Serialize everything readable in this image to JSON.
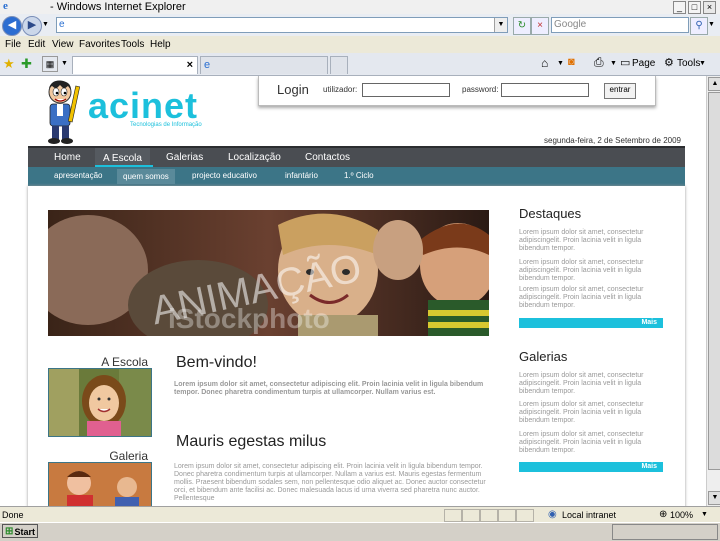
{
  "window": {
    "title": "- Windows Internet Explorer"
  },
  "address_bar": {
    "search_placeholder": "Google"
  },
  "menu": [
    "File",
    "Edit",
    "View",
    "Favorites",
    "Tools",
    "Help"
  ],
  "toolbar": {
    "page_label": "Page",
    "tools_label": "Tools"
  },
  "login": {
    "title": "Login",
    "user_label": "utilizador:",
    "password_label": "password:",
    "button": "entrar"
  },
  "logo": {
    "text": "acinet",
    "tagline": "Tecnologias de Informação"
  },
  "date": "segunda-feira, 2 de Setembro de 2009",
  "main_nav": [
    "Home",
    "A Escola",
    "Galerias",
    "Localização",
    "Contactos"
  ],
  "main_nav_active": "A Escola",
  "sub_nav": [
    "apresentação",
    "quem somos",
    "projecto educativo",
    "infantário",
    "1.º Ciclo"
  ],
  "sub_nav_active": "quem somos",
  "banner": {
    "watermark1": "ANIMAÇÃO",
    "watermark2": "iStockphoto"
  },
  "sidebar_left": {
    "escola_title": "A Escola",
    "galeria_title": "Galeria"
  },
  "content": {
    "welcome_title": "Bem-vindo!",
    "welcome_text": "Lorem ipsum dolor sit amet, consectetur adipiscing elit. Proin lacinia velit in ligula bibendum tempor. Donec pharetra condimentum turpis at ullamcorper. Nullam varius est.",
    "section2_title": "Mauris egestas milus",
    "section2_text": "Lorem ipsum dolor sit amet, consectetur adipiscing elit. Proin lacinia velit in ligula bibendum tempor. Donec pharetra condimentum turpis at ullamcorper. Nullam a varius est. Mauris egestas fermentum mollis. Praesent bibendum sodales sem, non pellentesque odio aliquet ac. Donec auctor consectetur orci, et bibendum ante facilisi ac. Donec malesuada lacus id urna viverra sed pharetra nunc auctor. Pellentesque"
  },
  "destaques": {
    "title": "Destaques",
    "items": [
      "Lorem ipsum dolor sit amet, consectetur adipiscingelit. Proin lacinia velit in ligula bibendum tempor.",
      "Lorem ipsum dolor sit amet, consectetur adipiscingelit. Proin lacinia velit in ligula bibendum tempor.",
      "Lorem ipsum dolor sit amet, consectetur adipiscingelit. Proin lacinia velit in ligula bibendum tempor."
    ],
    "more": "Mais"
  },
  "galerias": {
    "title": "Galerias",
    "items": [
      "Lorem ipsum dolor sit amet, consectetur adipiscingelit. Proin lacinia velit in ligula bibendum tempor.",
      "Lorem ipsum dolor sit amet, consectetur adipiscingelit. Proin lacinia velit in ligula bibendum tempor.",
      "Lorem ipsum dolor sit amet, consectetur adipiscingelit. Proin lacinia velit in ligula bibendum tempor."
    ],
    "more": "Mais"
  },
  "status": {
    "text": "Done",
    "zone": "Local intranet",
    "zoom": "100%"
  },
  "taskbar": {
    "start": "Start"
  },
  "colors": {
    "accent": "#1cc0dc",
    "nav": "#4a4d52",
    "subnav": "#3c7587"
  }
}
